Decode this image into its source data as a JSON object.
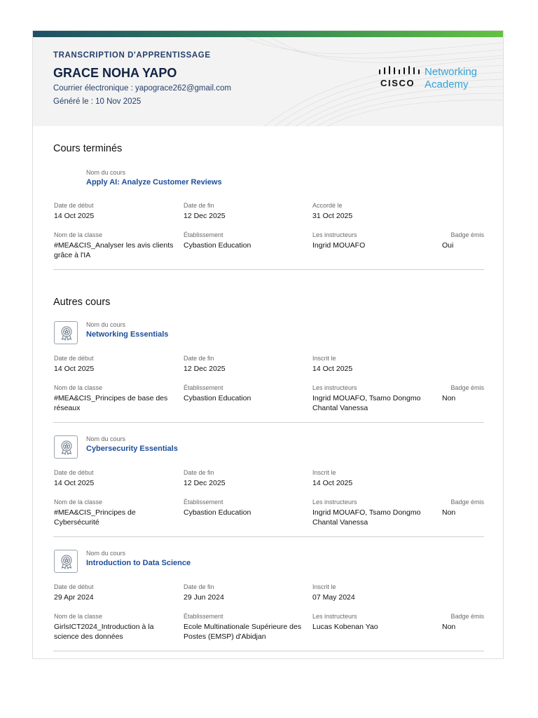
{
  "header": {
    "kicker": "TRANSCRIPTION D'APPRENTISSAGE",
    "name": "GRACE NOHA YAPO",
    "email_line": "Courrier électronique : yapograce262@gmail.com",
    "generated_line": "Généré le : 10 Nov 2025",
    "logo_cisco": "CISCO",
    "logo_line1": "Networking",
    "logo_line2": "Academy"
  },
  "labels": {
    "course_name": "Nom du cours",
    "start": "Date de début",
    "end": "Date de fin",
    "granted": "Accordé le",
    "enrolled": "Inscrit le",
    "class_name": "Nom de la classe",
    "institution": "Établissement",
    "instructors": "Les instructeurs",
    "badge": "Badge émis"
  },
  "completed": {
    "title": "Cours terminés",
    "courses": [
      {
        "name": "Apply AI: Analyze Customer Reviews",
        "start": "14 Oct 2025",
        "end": "12 Dec 2025",
        "granted": "31 Oct 2025",
        "class_line1": "#MEA&CIS_Analyser les avis clients",
        "class_line2": "grâce à l'IA",
        "institution_line1": "Cybastion Education",
        "institution_line2": "",
        "instructors_line1": "Ingrid MOUAFO",
        "instructors_line2": "",
        "badge": "Oui"
      }
    ]
  },
  "other": {
    "title": "Autres cours",
    "courses": [
      {
        "name": "Networking Essentials",
        "start": "14 Oct 2025",
        "end": "12 Dec 2025",
        "enrolled": "14 Oct 2025",
        "class_line1": "#MEA&CIS_Principes de base des",
        "class_line2": "réseaux",
        "institution_line1": "Cybastion Education",
        "institution_line2": "",
        "instructors_line1": "Ingrid MOUAFO, Tsamo Dongmo",
        "instructors_line2": "Chantal Vanessa",
        "badge": "Non"
      },
      {
        "name": "Cybersecurity Essentials",
        "start": "14 Oct 2025",
        "end": "12 Dec 2025",
        "enrolled": "14 Oct 2025",
        "class_line1": "#MEA&CIS_Principes de",
        "class_line2": "Cybersécurité",
        "institution_line1": "Cybastion Education",
        "institution_line2": "",
        "instructors_line1": "Ingrid MOUAFO, Tsamo Dongmo",
        "instructors_line2": "Chantal Vanessa",
        "badge": "Non"
      },
      {
        "name": "Introduction to Data Science",
        "start": "29 Apr 2024",
        "end": "29 Jun 2024",
        "enrolled": "07 May 2024",
        "class_line1": "GirlsICT2024_Introduction à la",
        "class_line2": "science des données",
        "institution_line1": "Ecole Multinationale Supérieure des",
        "institution_line2": "Postes (EMSP) d'Abidjan",
        "instructors_line1": "Lucas Kobenan Yao",
        "instructors_line2": "",
        "badge": "Non"
      }
    ]
  },
  "colors": {
    "accent_blue": "#1d4d9a",
    "header_text": "#27406b",
    "logo_blue": "#34a3d6",
    "bar_start": "#1f5066",
    "bar_end": "#62c33f"
  },
  "icons": {
    "course_badge": "award-badge-icon",
    "logo": "cisco-bars-logo"
  }
}
